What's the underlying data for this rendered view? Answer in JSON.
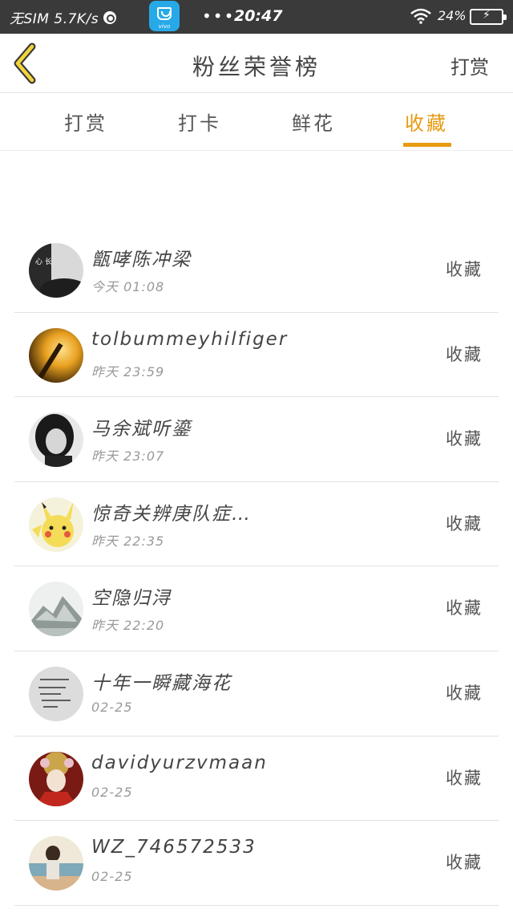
{
  "status_bar": {
    "carrier": "无SIM 5.7K/s",
    "app_brand": "vivo",
    "dots": "•••",
    "time": "20:47",
    "battery": "24%"
  },
  "header": {
    "title": "粉丝荣誉榜",
    "right_action": "打赏"
  },
  "tabs": [
    {
      "label": "打赏",
      "active": false
    },
    {
      "label": "打卡",
      "active": false
    },
    {
      "label": "鲜花",
      "active": false
    },
    {
      "label": "收藏",
      "active": true
    }
  ],
  "accent_color": "#e89a10",
  "list": [
    {
      "name": "甑哮陈冲梁",
      "time": "今天 01:08",
      "action": "收藏",
      "avatar": "avatar-dark-portrait"
    },
    {
      "name": "tolbummeyhilfiger",
      "time": "昨天 23:59",
      "action": "收藏",
      "avatar": "avatar-orange-glow"
    },
    {
      "name": "马余斌听鎏",
      "time": "昨天 23:07",
      "action": "收藏",
      "avatar": "avatar-girl-bw"
    },
    {
      "name": "惊奇关辨庚队症…",
      "time": "昨天 22:35",
      "action": "收藏",
      "avatar": "avatar-pikachu"
    },
    {
      "name": "空隐归浔",
      "time": "昨天 22:20",
      "action": "收藏",
      "avatar": "avatar-mountain"
    },
    {
      "name": "十年一瞬藏海花",
      "time": "02-25",
      "action": "收藏",
      "avatar": "avatar-handwriting"
    },
    {
      "name": "davidyurzvmaan",
      "time": "02-25",
      "action": "收藏",
      "avatar": "avatar-opera"
    },
    {
      "name": "WZ_746572533",
      "time": "02-25",
      "action": "收藏",
      "avatar": "avatar-seaside"
    }
  ]
}
